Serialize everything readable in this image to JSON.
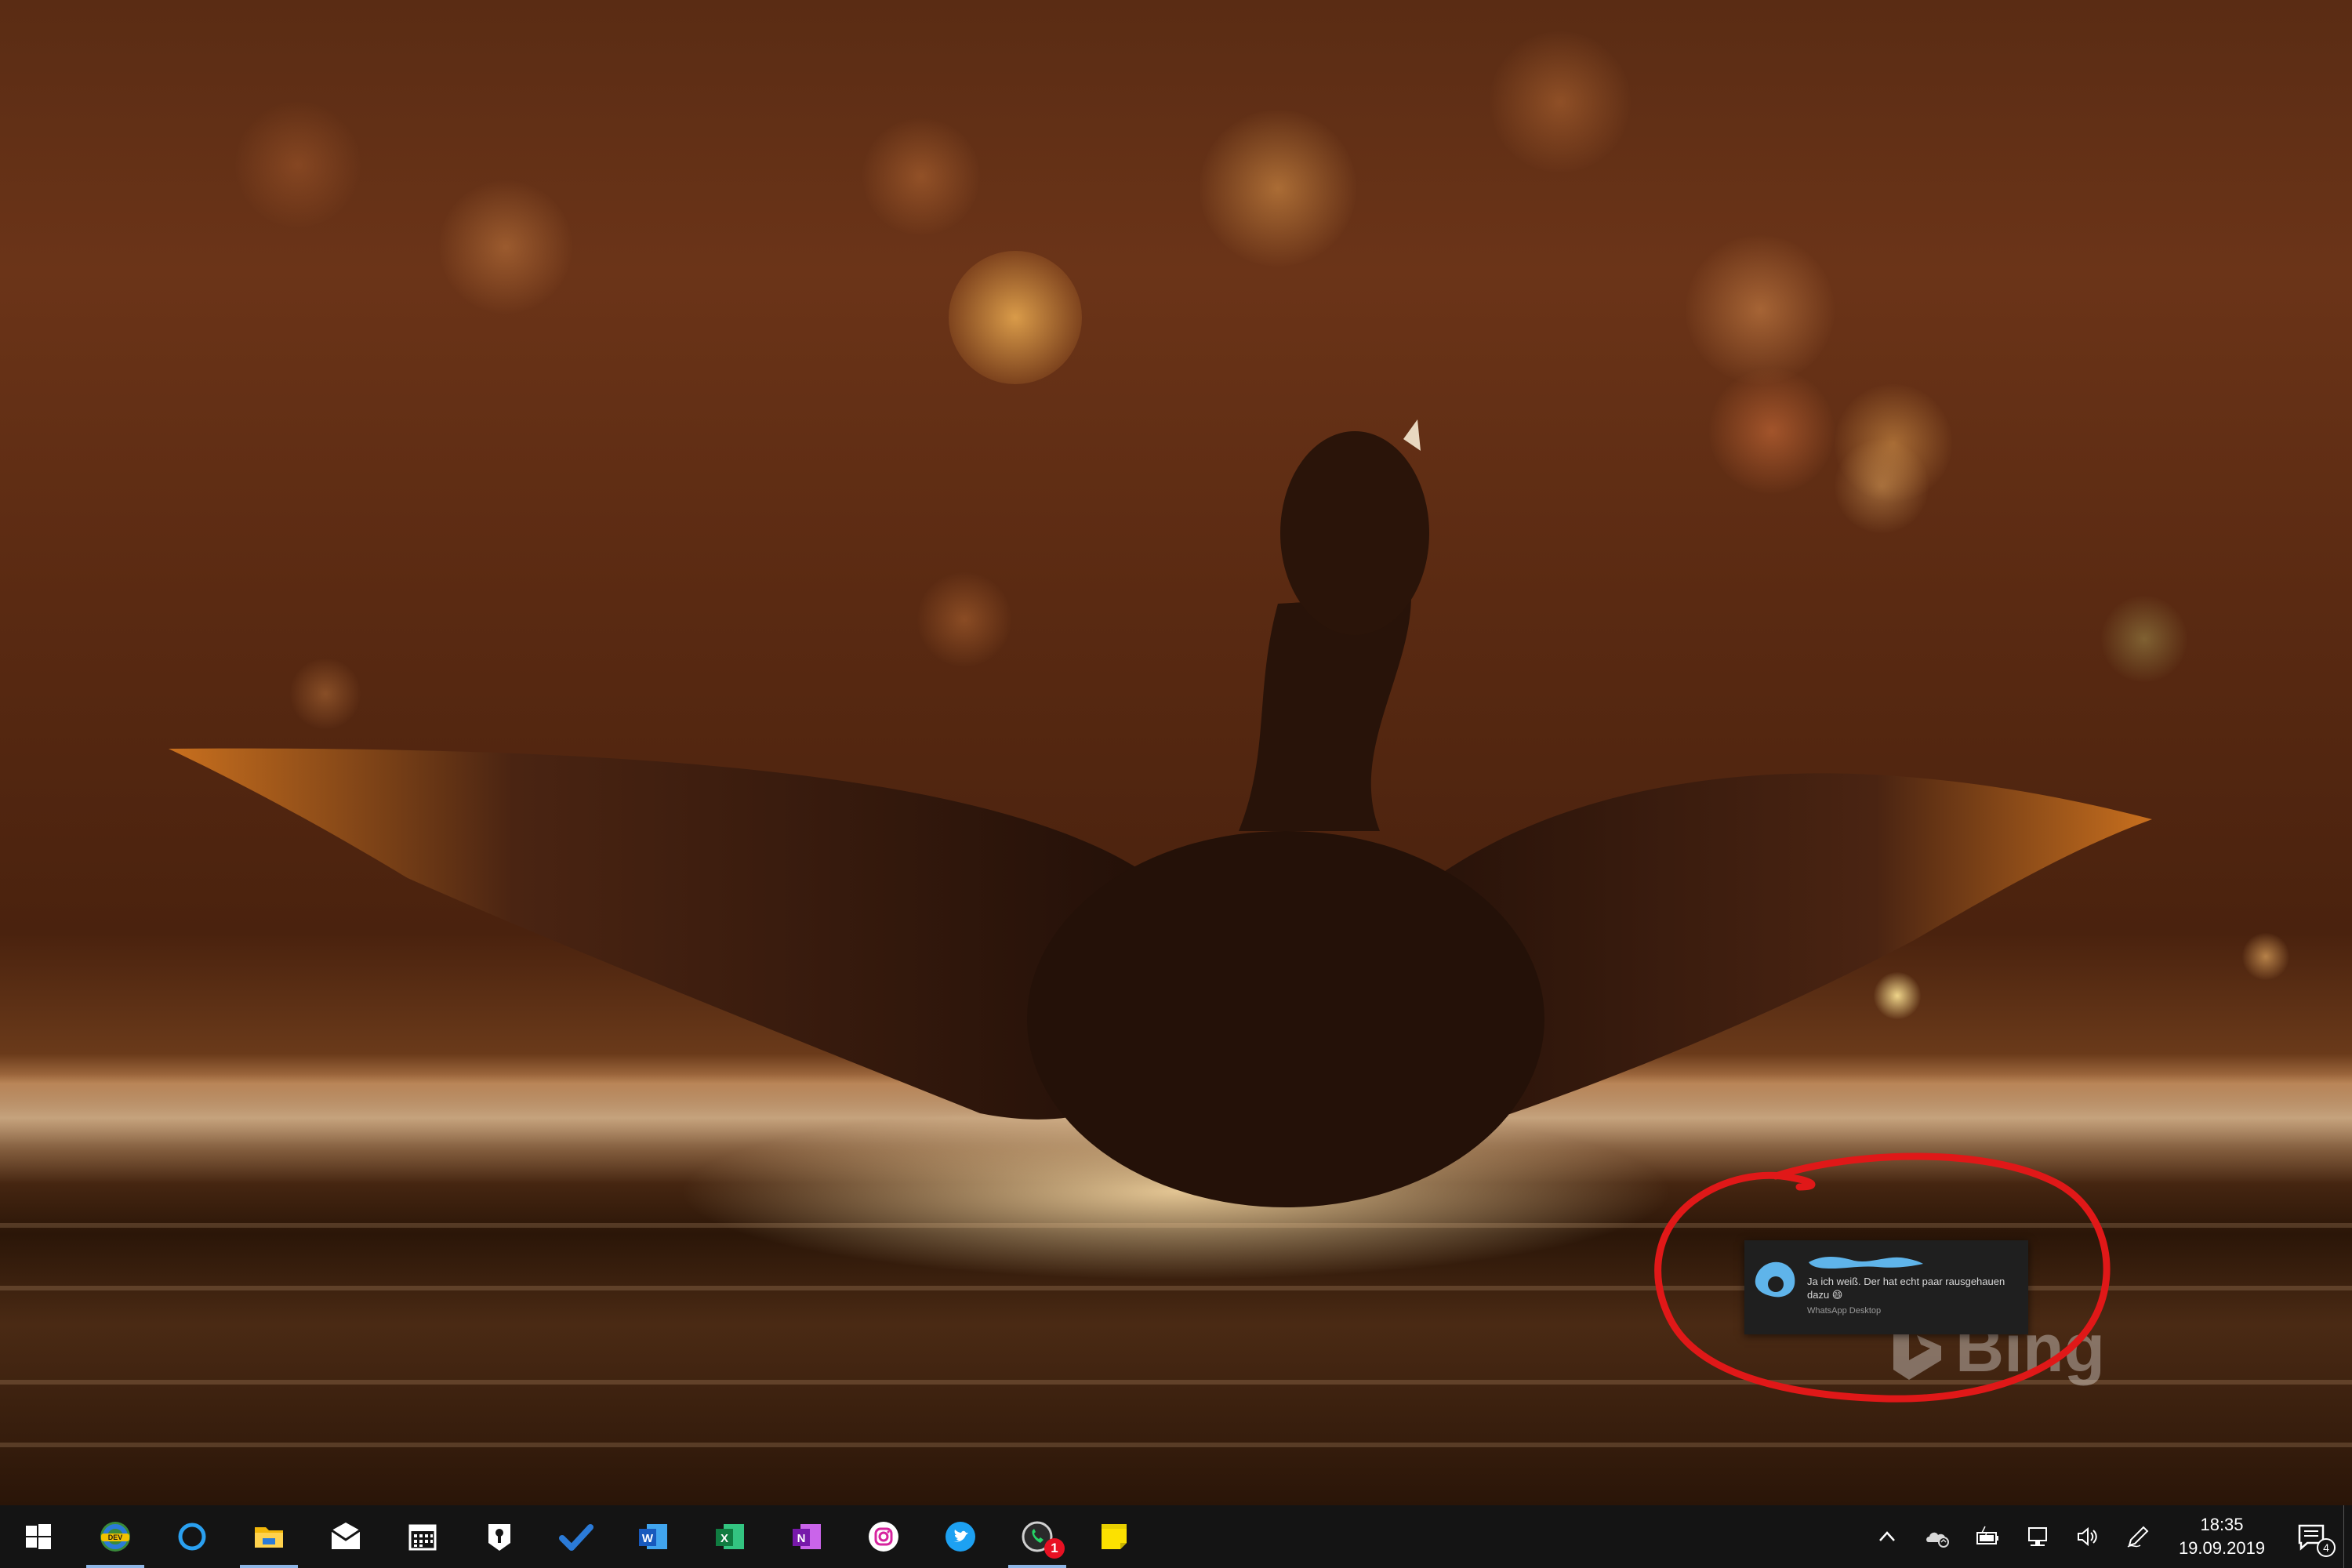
{
  "desktop": {
    "watermark": "Bing"
  },
  "toast": {
    "message": "Ja ich weiß. Der hat echt paar rausgehauen dazu 😄",
    "app_name": "WhatsApp Desktop"
  },
  "taskbar": {
    "apps": [
      {
        "name": "start-button",
        "icon": "windows-logo-icon"
      },
      {
        "name": "edge-dev",
        "icon": "edge-dev-icon"
      },
      {
        "name": "cortana",
        "icon": "cortana-ring-icon"
      },
      {
        "name": "file-explorer",
        "icon": "folder-icon"
      },
      {
        "name": "mail",
        "icon": "envelope-icon"
      },
      {
        "name": "calendar",
        "icon": "calendar-icon"
      },
      {
        "name": "keepass",
        "icon": "keyhole-icon"
      },
      {
        "name": "todo",
        "icon": "checkmark-icon"
      },
      {
        "name": "word",
        "icon": "word-icon"
      },
      {
        "name": "excel",
        "icon": "excel-icon"
      },
      {
        "name": "onenote",
        "icon": "onenote-icon"
      },
      {
        "name": "instagram",
        "icon": "instagram-icon"
      },
      {
        "name": "twitter",
        "icon": "twitter-icon"
      },
      {
        "name": "whatsapp",
        "icon": "whatsapp-icon",
        "badge": "1"
      },
      {
        "name": "sticky-notes",
        "icon": "sticky-note-icon"
      }
    ],
    "clock": {
      "time": "18:35",
      "date": "19.09.2019"
    },
    "notification_count": "4"
  }
}
